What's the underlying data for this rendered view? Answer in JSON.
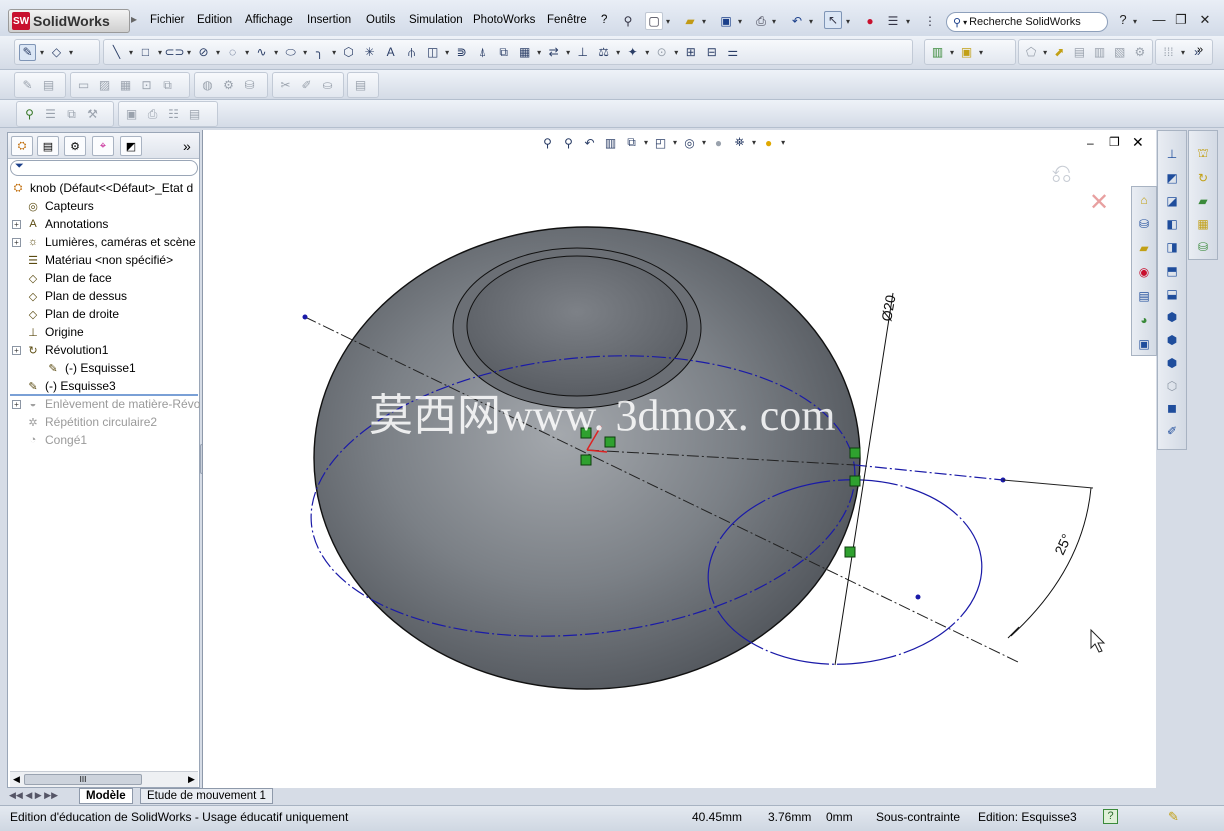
{
  "app": {
    "name": "SolidWorks",
    "logo_abbr": "SW"
  },
  "menu": [
    "Fichier",
    "Edition",
    "Affichage",
    "Insertion",
    "Outils",
    "Simulation",
    "PhotoWorks",
    "Fenêtre",
    "?"
  ],
  "search": {
    "label": "Recherche SolidWorks"
  },
  "window_controls": {
    "help": "?",
    "minimize": "—",
    "restore": "❐",
    "close": "✕"
  },
  "feature_tree": {
    "root": "knob  (Défaut<<Défaut>_Etat d",
    "items": [
      {
        "label": "Capteurs",
        "expandable": false,
        "dim": false,
        "icon": "sensor-icon"
      },
      {
        "label": "Annotations",
        "expandable": true,
        "dim": false,
        "icon": "annotation-icon"
      },
      {
        "label": "Lumières, caméras et scène",
        "expandable": true,
        "dim": false,
        "icon": "lights-icon"
      },
      {
        "label": "Matériau <non spécifié>",
        "expandable": false,
        "dim": false,
        "icon": "material-icon"
      },
      {
        "label": "Plan de face",
        "expandable": false,
        "dim": false,
        "icon": "plane-icon"
      },
      {
        "label": "Plan de dessus",
        "expandable": false,
        "dim": false,
        "icon": "plane-icon"
      },
      {
        "label": "Plan de droite",
        "expandable": false,
        "dim": false,
        "icon": "plane-icon"
      },
      {
        "label": "Origine",
        "expandable": false,
        "dim": false,
        "icon": "origin-icon"
      },
      {
        "label": "Révolution1",
        "expandable": true,
        "dim": false,
        "icon": "revolve-icon"
      },
      {
        "label": "(-) Esquisse1",
        "expandable": false,
        "dim": false,
        "icon": "sketch-icon",
        "indent": 1
      },
      {
        "label": "(-) Esquisse3",
        "expandable": false,
        "dim": false,
        "icon": "sketch-icon"
      },
      {
        "label": "Enlèvement de matière-Révo",
        "expandable": true,
        "dim": true,
        "icon": "cut-revolve-icon"
      },
      {
        "label": "Répétition circulaire2",
        "expandable": false,
        "dim": true,
        "icon": "pattern-icon"
      },
      {
        "label": "Congé1",
        "expandable": false,
        "dim": true,
        "icon": "fillet-icon"
      }
    ]
  },
  "panel_tabs": [
    "feature-manager",
    "property-manager",
    "configuration-manager",
    "dimxpert-manager",
    "display-manager"
  ],
  "panel_more": "»",
  "scroll_grip": "III",
  "bottom_tabs": [
    {
      "label": "Modèle",
      "active": true
    },
    {
      "label": "Etude de mouvement 1",
      "active": false
    }
  ],
  "viewport": {
    "watermark": "莫西网www. 3dmox. com",
    "dimension_diameter": "Ø20",
    "dimension_angle": "25°"
  },
  "statusbar": {
    "message": "Edition d'éducation de SolidWorks - Usage éducatif uniquement",
    "x": "40.45mm",
    "y": "3.76mm",
    "z": "0mm",
    "constraint": "Sous-contrainte",
    "editing": "Edition: Esquisse3",
    "help": "?"
  },
  "colors": {
    "accent": "#1f4d9c",
    "sketch_blue": "#1a1aa8",
    "body_grey": "#6f7378",
    "relation_green": "#2fa12f"
  }
}
